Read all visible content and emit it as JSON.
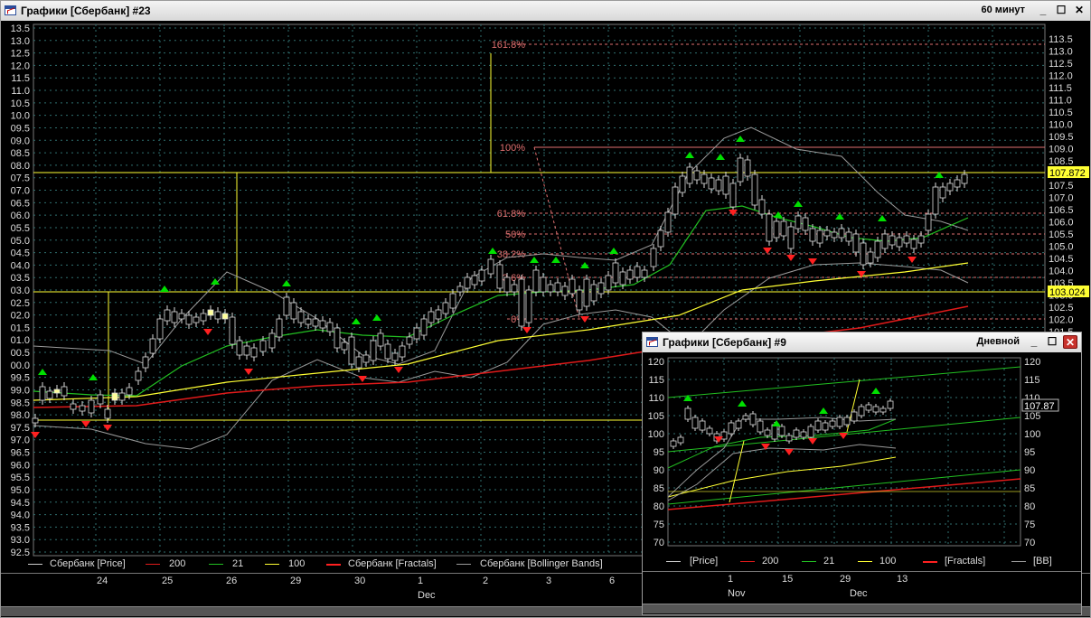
{
  "main": {
    "title": "Графики [Сбербанк] #23",
    "period": "60 минут",
    "price_tag": "107.872",
    "level_tag": "103.024",
    "left_ticks": [
      "13.5",
      "13.0",
      "12.5",
      "12.0",
      "11.5",
      "11.0",
      "10.5",
      "10.0",
      "09.5",
      "09.0",
      "08.5",
      "08.0",
      "07.5",
      "07.0",
      "06.5",
      "06.0",
      "05.5",
      "05.0",
      "04.5",
      "04.0",
      "03.5",
      "03.0",
      "02.5",
      "02.0",
      "01.5",
      "01.0",
      "00.5",
      "00.0",
      "99.5",
      "99.0",
      "98.5",
      "98.0",
      "97.5",
      "97.0",
      "96.5",
      "96.0",
      "95.5",
      "95.0",
      "94.5",
      "94.0",
      "93.5",
      "93.0",
      "92.5"
    ],
    "right_ticks": [
      "113.5",
      "113.0",
      "112.5",
      "112.0",
      "111.5",
      "111.0",
      "110.5",
      "110.0",
      "109.5",
      "109.0",
      "108.5",
      "108.0",
      "107.5",
      "107.0",
      "106.5",
      "106.0",
      "105.5",
      "105.0",
      "104.5",
      "104.0",
      "103.5",
      "103.0",
      "102.5",
      "102.0",
      "101.5"
    ],
    "fib_labels": [
      "161.8%",
      "100%",
      "61.8%",
      "50%",
      "38.2%",
      "23.6%",
      "0%"
    ],
    "legend": [
      "Сбербанк [Price]",
      "200",
      "21",
      "100",
      "Сбербанк [Fractals]",
      "Сбербанк [Bollinger Bands]"
    ],
    "day_labels": [
      "24",
      "25",
      "26",
      "29",
      "30",
      "1",
      "2",
      "3",
      "6"
    ],
    "month_label": "Dec"
  },
  "popup": {
    "title": "Графики [Сбербанк] #9",
    "period": "Дневной",
    "price_tag": "107.87",
    "left_ticks": [
      "120",
      "115",
      "110",
      "105",
      "100",
      "95",
      "90",
      "85",
      "80",
      "75",
      "70"
    ],
    "right_ticks": [
      "120",
      "115",
      "110",
      "105",
      "100",
      "95",
      "90",
      "85",
      "80",
      "75",
      "70"
    ],
    "legend": [
      "[Price]",
      "200",
      "21",
      "100",
      "[Fractals]",
      "[BB]"
    ],
    "day_labels": [
      "1",
      "15",
      "29",
      "13"
    ],
    "month_labels": [
      "Nov",
      "Dec"
    ]
  },
  "colors": {
    "yellow": "#ffff33",
    "green_line": "#22c022",
    "red_line": "#e01a1a",
    "fractal_up": "#00e000",
    "fractal_down": "#ff2020",
    "fib": "#e07070",
    "bb": "#9a9a9a",
    "grid": "#2f6f6f"
  },
  "chart_data": {
    "type": "candlestick",
    "ylim": [
      92.5,
      113.5
    ],
    "close_last": 107.872,
    "fib_levels": {
      "161.8%": 113.1,
      "100%": 108.9,
      "61.8%": 106.2,
      "50%": 105.4,
      "38.2%": 104.6,
      "23.6%": 103.6,
      "0%": 101.9
    }
  }
}
